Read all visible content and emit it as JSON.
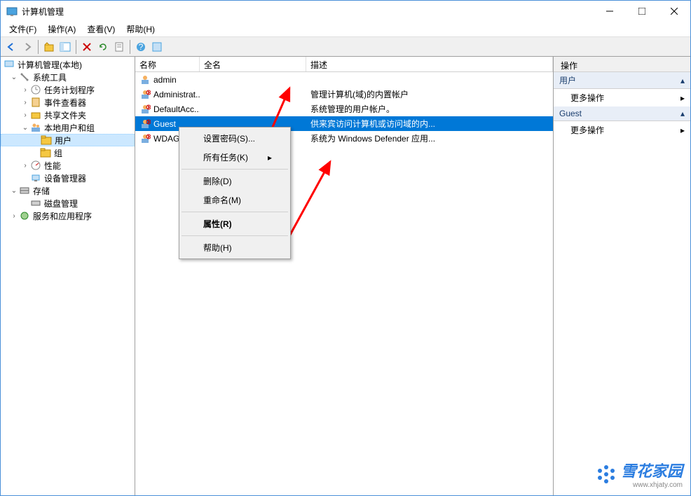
{
  "window": {
    "title": "计算机管理"
  },
  "menubar": {
    "file": "文件(F)",
    "action": "操作(A)",
    "view": "查看(V)",
    "help": "帮助(H)"
  },
  "tree": {
    "root": "计算机管理(本地)",
    "system_tools": "系统工具",
    "task_scheduler": "任务计划程序",
    "event_viewer": "事件查看器",
    "shared_folders": "共享文件夹",
    "local_users_groups": "本地用户和组",
    "users": "用户",
    "groups": "组",
    "performance": "性能",
    "device_manager": "设备管理器",
    "storage": "存储",
    "disk_management": "磁盘管理",
    "services_apps": "服务和应用程序"
  },
  "list_headers": {
    "name": "名称",
    "full_name": "全名",
    "description": "描述"
  },
  "users": [
    {
      "name": "admin",
      "full_name": "",
      "description": ""
    },
    {
      "name": "Administrat...",
      "full_name": "",
      "description": "管理计算机(域)的内置帐户"
    },
    {
      "name": "DefaultAcc...",
      "full_name": "",
      "description": "系统管理的用户帐户。"
    },
    {
      "name": "Guest",
      "full_name": "",
      "description": "供来宾访问计算机或访问域的内..."
    },
    {
      "name": "WDAG...",
      "full_name": "",
      "description": "系统为 Windows Defender 应用..."
    }
  ],
  "context_menu": {
    "set_password": "设置密码(S)...",
    "all_tasks": "所有任务(K)",
    "delete": "删除(D)",
    "rename": "重命名(M)",
    "properties": "属性(R)",
    "help": "帮助(H)"
  },
  "actions": {
    "header": "操作",
    "section_user": "用户",
    "more_actions": "更多操作",
    "section_guest": "Guest"
  },
  "watermark": {
    "text": "雪花家园",
    "url": "www.xhjaty.com"
  }
}
